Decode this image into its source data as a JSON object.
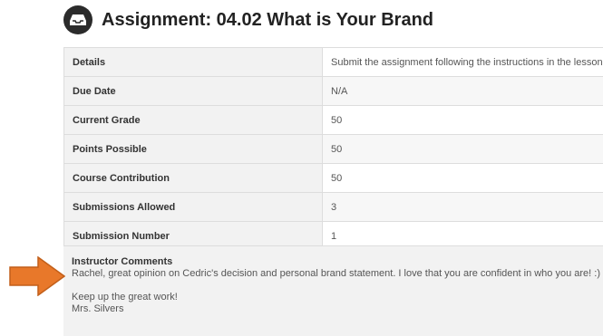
{
  "title": "Assignment: 04.02 What is Your Brand",
  "icon": "assignment-icon",
  "rows": [
    {
      "label": "Details",
      "value": "Submit the assignment following the instructions in the lesson."
    },
    {
      "label": "Due Date",
      "value": "N/A"
    },
    {
      "label": "Current Grade",
      "value": "50"
    },
    {
      "label": "Points Possible",
      "value": "50"
    },
    {
      "label": "Course Contribution",
      "value": "50"
    },
    {
      "label": "Submissions Allowed",
      "value": "3"
    },
    {
      "label": "Submission Number",
      "value": "1"
    }
  ],
  "instructor_comments": {
    "heading": "Instructor Comments",
    "line1": "Rachel, great opinion on Cedric's decision and personal brand statement. I love that you are confident in who you are! :)",
    "line2": "Keep up the great work!",
    "line3": "Mrs. Silvers"
  },
  "colors": {
    "arrow": "#e8782a",
    "label_background": "#f2f2f2",
    "icon_background": "#2b2b2b"
  }
}
